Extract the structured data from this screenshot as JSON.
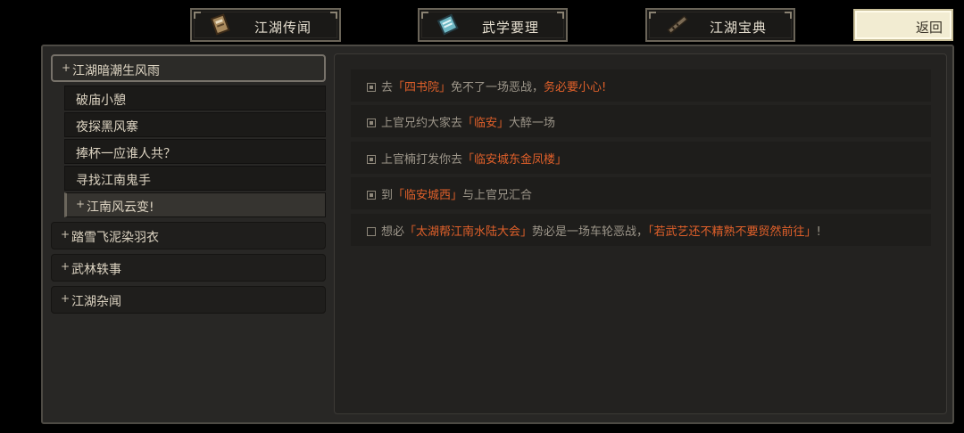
{
  "tabs": [
    {
      "label": "江湖传闻",
      "icon": "scroll-book-icon"
    },
    {
      "label": "武学要理",
      "icon": "manual-book-icon"
    },
    {
      "label": "江湖宝典",
      "icon": "flute-icon"
    }
  ],
  "back_label": "返回",
  "chapters": [
    {
      "label": "江湖暗潮生风雨",
      "expanded": true
    },
    {
      "label": "踏雪飞泥染羽衣"
    },
    {
      "label": "武林轶事"
    },
    {
      "label": "江湖杂闻"
    }
  ],
  "subchapters": [
    {
      "label": "破庙小憩"
    },
    {
      "label": "夜探黑风寨"
    },
    {
      "label": "捧杯一应谁人共？"
    },
    {
      "label": "寻找江南鬼手"
    },
    {
      "label": "江南风云变!",
      "selected": true
    }
  ],
  "quests": [
    {
      "done": true,
      "parts": [
        {
          "t": "去"
        },
        {
          "t": "「四书院」",
          "h": true
        },
        {
          "t": "免不了一场恶战，"
        },
        {
          "t": "务必要小心!",
          "h": true
        }
      ]
    },
    {
      "done": true,
      "parts": [
        {
          "t": "上官兄约大家去"
        },
        {
          "t": "「临安」",
          "h": true
        },
        {
          "t": "大醉一场"
        }
      ]
    },
    {
      "done": true,
      "parts": [
        {
          "t": "上官楠打发你去"
        },
        {
          "t": "「临安城东金凤楼」",
          "h": true
        }
      ]
    },
    {
      "done": true,
      "parts": [
        {
          "t": "到"
        },
        {
          "t": "「临安城西」",
          "h": true
        },
        {
          "t": "与上官兄汇合"
        }
      ]
    },
    {
      "done": false,
      "parts": [
        {
          "t": "想必"
        },
        {
          "t": "「太湖帮江南水陆大会」",
          "h": true
        },
        {
          "t": "势必是一场车轮恶战，"
        },
        {
          "t": "「若武艺还不精熟不要贸然前往」",
          "h": true
        },
        {
          "t": "!"
        }
      ]
    }
  ],
  "colors": {
    "highlight": "#e0602a",
    "text_muted": "#9d968a",
    "back_bg": "#f2ecd2"
  }
}
